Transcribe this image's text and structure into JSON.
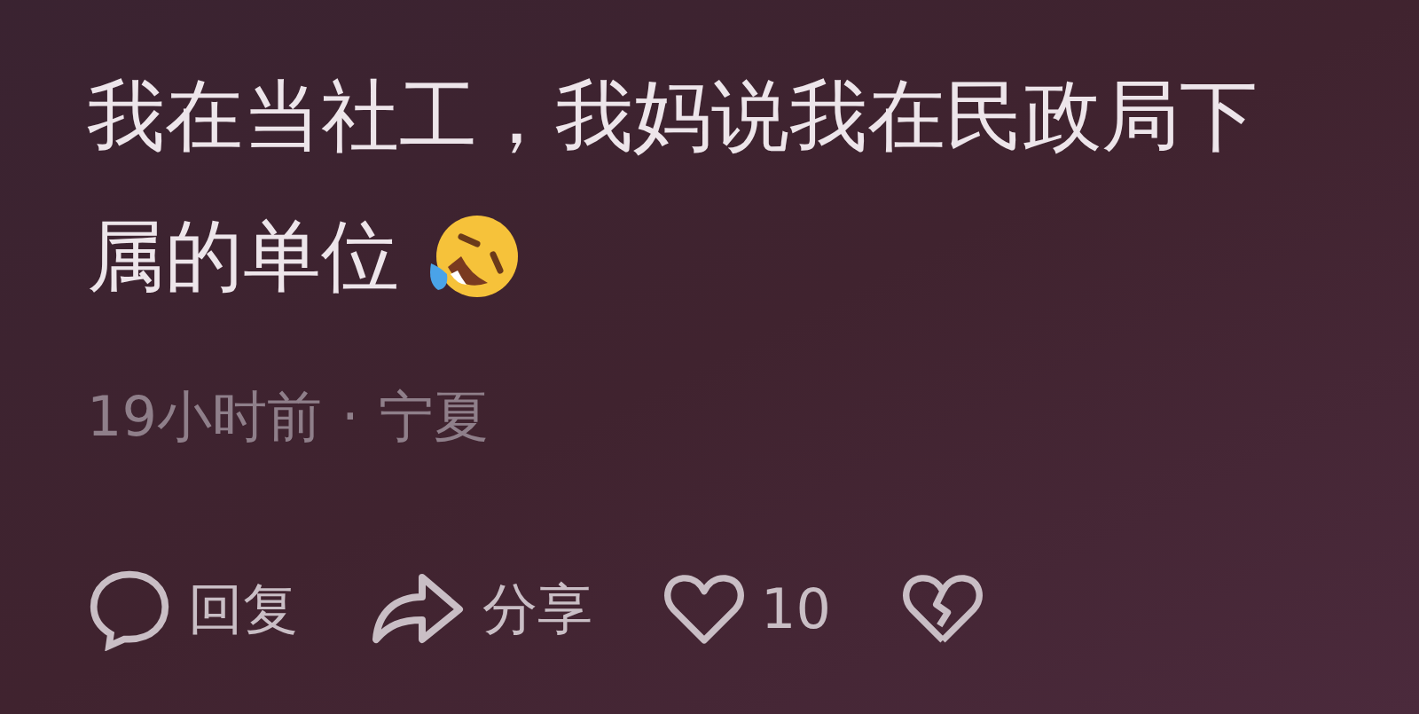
{
  "comment": {
    "lines": [
      "我在当社工，我妈说我在民政局下",
      "属的单位"
    ]
  },
  "meta": {
    "time": "19小时前",
    "separator": "·",
    "location": "宁夏"
  },
  "actions": [
    {
      "kind": "reply",
      "label": "回复"
    },
    {
      "kind": "share",
      "label": "分享"
    },
    {
      "kind": "like",
      "label": "10"
    },
    {
      "kind": "dislike"
    }
  ]
}
